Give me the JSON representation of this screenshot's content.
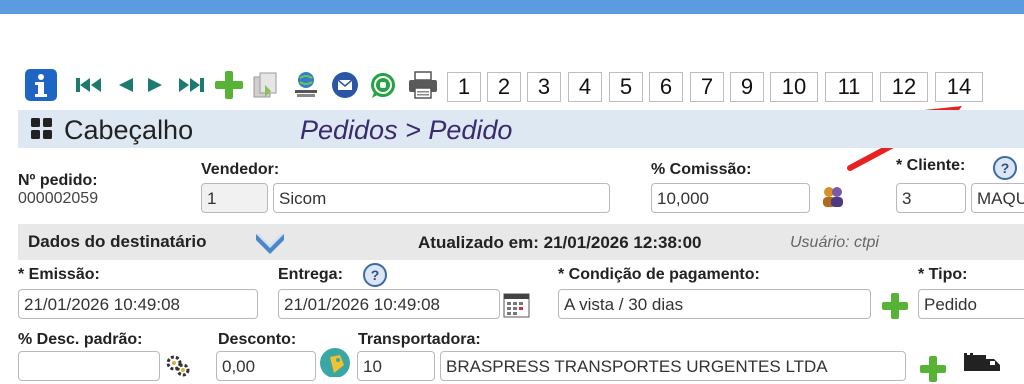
{
  "colors": {
    "top_bar": "#5b9be0",
    "header_bar": "#dde8f3",
    "accent_green": "#56b336",
    "arrow": "#e8221f",
    "breadcrumb": "#3b2a6e"
  },
  "toolbar": {
    "icons": [
      "info-icon",
      "first-record-icon",
      "prev-record-icon",
      "next-record-icon",
      "last-record-icon",
      "add-icon",
      "copy-icon",
      "web-icon",
      "email-icon",
      "whatsapp-icon",
      "print-icon"
    ],
    "tabs": [
      "1",
      "2",
      "3",
      "4",
      "5",
      "6",
      "7",
      "9",
      "10",
      "11",
      "12",
      "14"
    ]
  },
  "header": {
    "title": "Cabeçalho",
    "breadcrumb": "Pedidos > Pedido"
  },
  "form": {
    "numero_label": "Nº pedido:",
    "numero_value": "000002059",
    "vendedor_label": "Vendedor:",
    "vendedor_code": "1",
    "vendedor_name": "Sicom",
    "comissao_label": "% Comissão:",
    "comissao_value": "10,000",
    "cliente_label": "* Cliente:",
    "cliente_code": "3",
    "cliente_name": "MAQU",
    "emissao_label": "* Emissão:",
    "emissao_value": "21/01/2026 10:49:08",
    "entrega_label": "Entrega:",
    "entrega_value": "21/01/2026 10:49:08",
    "condicao_label": "* Condição de pagamento:",
    "condicao_value": "A vista / 30 dias",
    "tipo_label": "* Tipo:",
    "tipo_value": "Pedido",
    "desc_padrao_label": "% Desc. padrão:",
    "desc_padrao_value": "",
    "desconto_label": "Desconto:",
    "desconto_value": "0,00",
    "transportadora_label": "Transportadora:",
    "transportadora_code": "10",
    "transportadora_name": "BRASPRESS TRANSPORTES URGENTES LTDA"
  },
  "section": {
    "title": "Dados do destinatário",
    "updated": "Atualizado em: 21/01/2026 12:38:00",
    "user": "Usuário: ctpi"
  },
  "help_symbol": "?"
}
